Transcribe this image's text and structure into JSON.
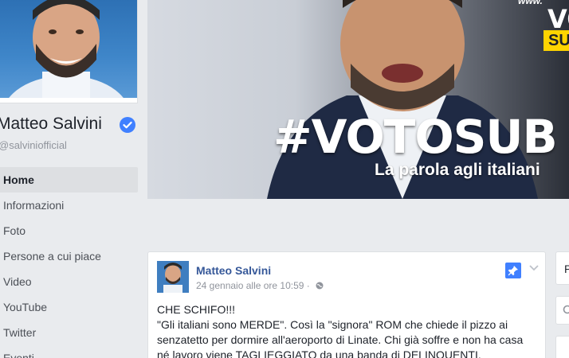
{
  "profile": {
    "name": "Matteo Salvini",
    "handle": "@salviniofficial"
  },
  "nav": {
    "items": [
      {
        "label": "Home",
        "active": true
      },
      {
        "label": "Informazioni",
        "active": false
      },
      {
        "label": "Foto",
        "active": false
      },
      {
        "label": "Persone a cui piace",
        "active": false
      },
      {
        "label": "Video",
        "active": false
      },
      {
        "label": "YouTube",
        "active": false
      },
      {
        "label": "Twitter",
        "active": false
      },
      {
        "label": "Eventi",
        "active": false
      }
    ]
  },
  "cover": {
    "headline": "#VOTOSUB",
    "tagline": "La parola agli italiani",
    "corner_text": "VO",
    "corner_badge": "SU"
  },
  "post": {
    "author": "Matteo Salvini",
    "timestamp": "24 gennaio alle ore 10:59 ·",
    "lines": [
      "CHE SCHIFO!!!",
      "\"Gli italiani sono MERDE\". Così la \"signora\" ROM che chiede il pizzo ai",
      "senzatetto per dormire all'aeroporto di Linate. Chi già soffre e non ha casa",
      "né lavoro viene TAGLIEGGIATO da una banda di DELINQUENTI."
    ]
  },
  "side": {
    "card1_letter": "P"
  },
  "colors": {
    "link": "#365899",
    "verified": "#4080ff",
    "pin": "#4080ff",
    "background": "#e9ebee"
  }
}
